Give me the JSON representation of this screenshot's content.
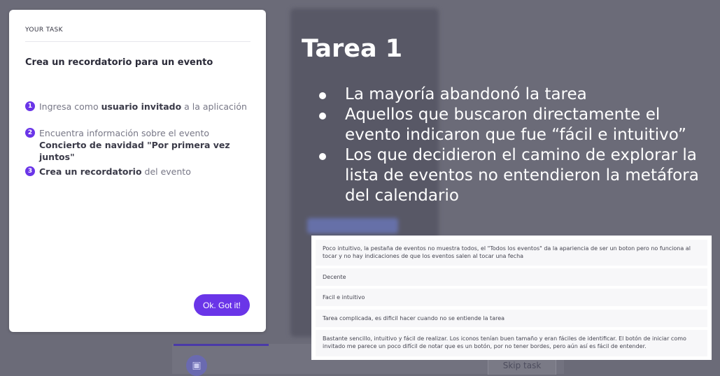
{
  "task": {
    "label": "YOUR TASK",
    "title": "Crea un recordatorio para un evento",
    "steps": [
      {
        "number": "1",
        "pre": "Ingresa como ",
        "bold": "usuario invitado",
        "post": " a la aplicación"
      },
      {
        "number": "2",
        "pre": "Encuentra información sobre el evento ",
        "bold": "Concierto de navidad \"Por primera vez juntos\"",
        "post": ""
      },
      {
        "number": "3",
        "pre": "",
        "bold": "Crea un recordatorio",
        "post": " del evento"
      }
    ],
    "ok_label": "Ok. Got it!"
  },
  "background": {
    "skip_label": "Skip task",
    "calendar_icon": "calendar-icon"
  },
  "slide": {
    "title": "Tarea 1",
    "bullets": [
      "La mayoría abandonó la tarea",
      "Aquellos que buscaron directamente el evento indicaron que fue “fácil e intuitivo”",
      "Los que decidieron el camino de explorar la lista de eventos no entendieron la metáfora del calendario"
    ]
  },
  "responses": [
    "Poco intuitivo, la pestaña de eventos no muestra todos, el \"Todos los eventos\" da la apariencia de ser un boton pero no funciona al tocar y no hay indicaciones de que los eventos salen al tocar una fecha",
    "Decente",
    "Facil e intuitivo",
    "Tarea complicada, es dificil hacer cuando no se entiende la tarea",
    "Bastante sencillo, intuitivo y fácil de realizar. Los iconos tenían buen tamaño y eran fáciles de identificar. El botón de iniciar como invitado me parece un poco difícil de notar que es un botón, por no tener bordes, pero aún así es fácil de entender."
  ],
  "colors": {
    "accent": "#6a35e8",
    "overlay": "#6b6b78"
  }
}
